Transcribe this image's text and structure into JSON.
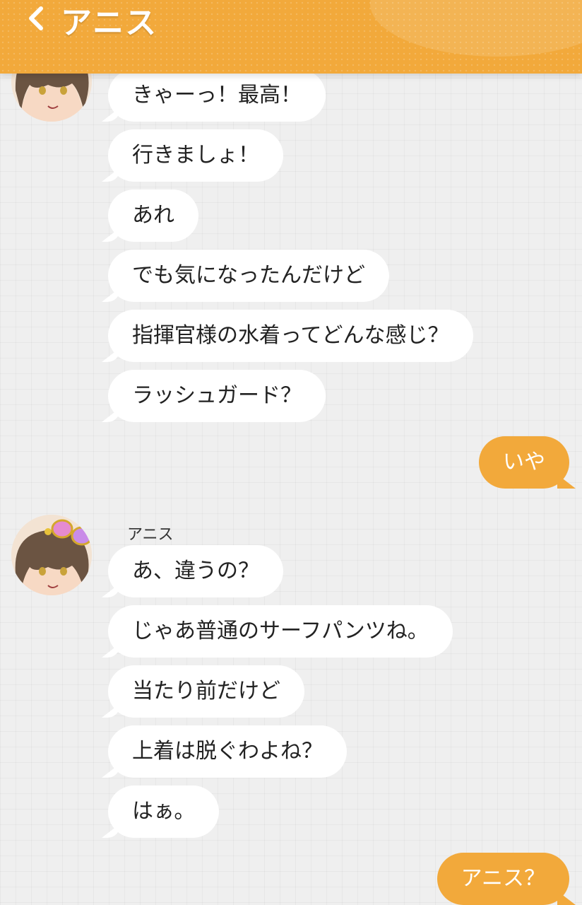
{
  "header": {
    "title": "アニス",
    "back_icon": "chevron-left-icon",
    "color": "#f2a93b"
  },
  "contact": {
    "name": "アニス",
    "avatar": "character-avatar"
  },
  "messages_group1": [
    "きゃーっ！最高！",
    "行きましょ！",
    "あれ",
    "でも気になったんだけど",
    "指揮官様の水着ってどんな感じ？",
    "ラッシュガード？"
  ],
  "reply1": "いや",
  "messages_group2": [
    "あ、違うの？",
    "じゃあ普通のサーフパンツね。",
    "当たり前だけど",
    "上着は脱ぐわよね？",
    "はぁ。"
  ],
  "reply2": "アニス？"
}
